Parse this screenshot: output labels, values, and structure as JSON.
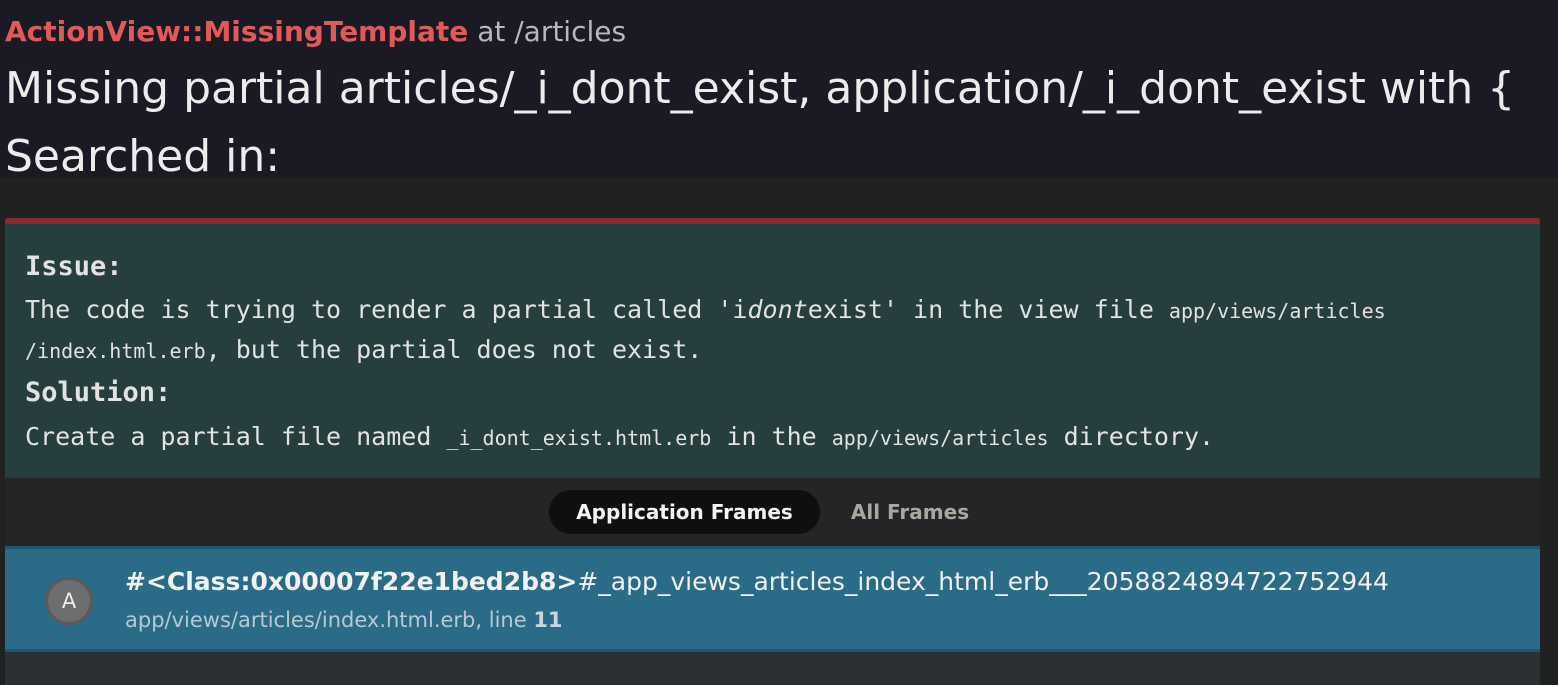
{
  "header": {
    "exception_class": "ActionView::MissingTemplate",
    "at_text": "at /articles",
    "message": "Missing partial articles/_i_dont_exist, application/_i_dont_exist with {",
    "searched_in": "Searched in:"
  },
  "ai_explanation": {
    "issue_heading": "Issue:",
    "issue_text_1": "The code is trying to render a partial called 'i",
    "issue_text_italic": "dont",
    "issue_text_2": "exist' in the view file ",
    "issue_code_1": "app/views/articles",
    "issue_code_2": "/index.html.erb",
    "issue_text_3": ", but the partial does not exist.",
    "solution_heading": "Solution:",
    "solution_text_1": "Create a partial file named ",
    "solution_code_1": "_i_dont_exist.html.erb",
    "solution_text_2": " in the ",
    "solution_code_2": "app/views/articles",
    "solution_text_3": " directory."
  },
  "tabs": {
    "application_frames": "Application Frames",
    "all_frames": "All Frames"
  },
  "frames": [
    {
      "avatar_letter": "A",
      "class_part": "#<Class:0x00007f22e1bed2b8>",
      "method_part": "#_app_views_articles_index_html_erb___2058824894722752944",
      "location": "app/views/articles/index.html.erb, line ",
      "line": "11"
    }
  ],
  "colors": {
    "exception_red": "#e05a5a",
    "ai_box_bg": "#263e3e",
    "frame_selected_bg": "#2a6b87",
    "panel_top_bar": "#8b2a2a"
  }
}
